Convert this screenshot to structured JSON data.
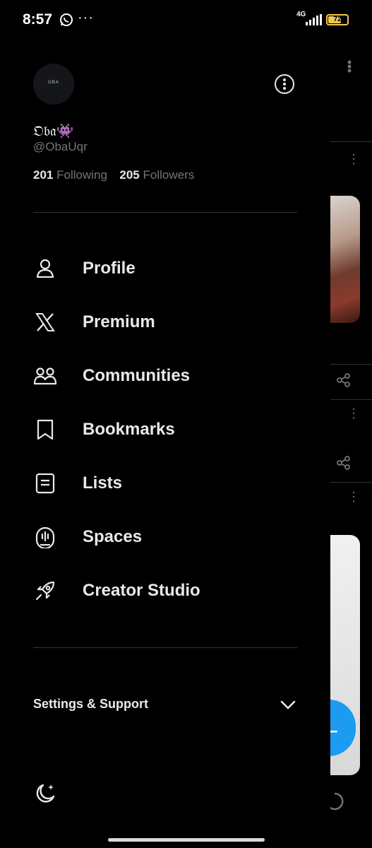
{
  "status_bar": {
    "time": "8:57",
    "network": "4G",
    "battery": "72",
    "battery_level": 0.72
  },
  "profile": {
    "avatar_text": "OBA",
    "display_name": "𝔒𝔟𝔞👾",
    "handle": "@ObaUqr",
    "following_count": "201",
    "following_label": "Following",
    "followers_count": "205",
    "followers_label": "Followers"
  },
  "nav": {
    "items": [
      {
        "label": "Profile",
        "icon": "person-icon"
      },
      {
        "label": "Premium",
        "icon": "x-logo-icon"
      },
      {
        "label": "Communities",
        "icon": "communities-icon"
      },
      {
        "label": "Bookmarks",
        "icon": "bookmark-icon"
      },
      {
        "label": "Lists",
        "icon": "list-icon"
      },
      {
        "label": "Spaces",
        "icon": "spaces-icon"
      },
      {
        "label": "Creator Studio",
        "icon": "rocket-icon"
      }
    ]
  },
  "settings": {
    "label": "Settings & Support"
  },
  "colors": {
    "background": "#000000",
    "text": "#e7e9ea",
    "secondary": "#71767b",
    "divider": "#2f3336",
    "accent": "#1d9bf0",
    "battery": "#f2c94c"
  }
}
